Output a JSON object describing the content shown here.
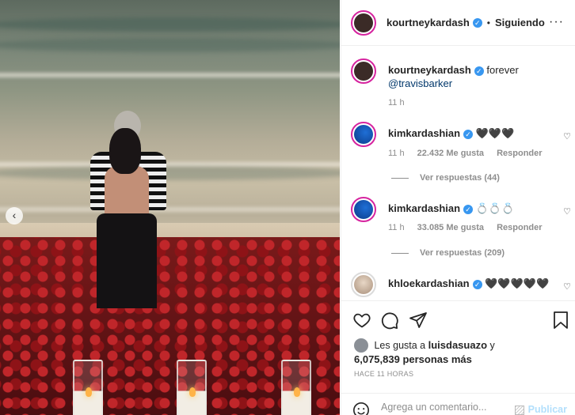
{
  "post": {
    "author": "kourtneykardash",
    "follow_status": "Siguiendo",
    "dot": "•",
    "more": "···",
    "caption_user": "kourtneykardash",
    "caption_text": "forever",
    "caption_mention": "@travisbarker",
    "caption_time": "11 h"
  },
  "comments": [
    {
      "user": "kimkardashian",
      "text": "🖤🖤🖤",
      "time": "11 h",
      "likes": "22.432 Me gusta",
      "reply": "Responder",
      "view_replies": "Ver respuestas (44)"
    },
    {
      "user": "kimkardashian",
      "text": "💍💍💍",
      "time": "11 h",
      "likes": "33.085 Me gusta",
      "reply": "Responder",
      "view_replies": "Ver respuestas (209)"
    },
    {
      "user": "khloekardashian",
      "text": "🖤🖤🖤🖤🖤"
    }
  ],
  "likes": {
    "prefix": "Les gusta a",
    "user": "luisdasuazo",
    "and": "y",
    "count": "6,075,839 personas más"
  },
  "timestamp": "HACE 11 HORAS",
  "composer": {
    "placeholder": "Agrega un comentario...",
    "publish": "Publicar"
  },
  "icons": [
    "heart-icon",
    "comment-icon",
    "share-icon",
    "bookmark-icon",
    "emoji-icon",
    "verified-badge-icon",
    "chevron-left-icon"
  ],
  "colors": {
    "verified": "#3897f0",
    "story_ring": "#d6249f",
    "publish": "#b2dffc",
    "link": "#00376b"
  }
}
